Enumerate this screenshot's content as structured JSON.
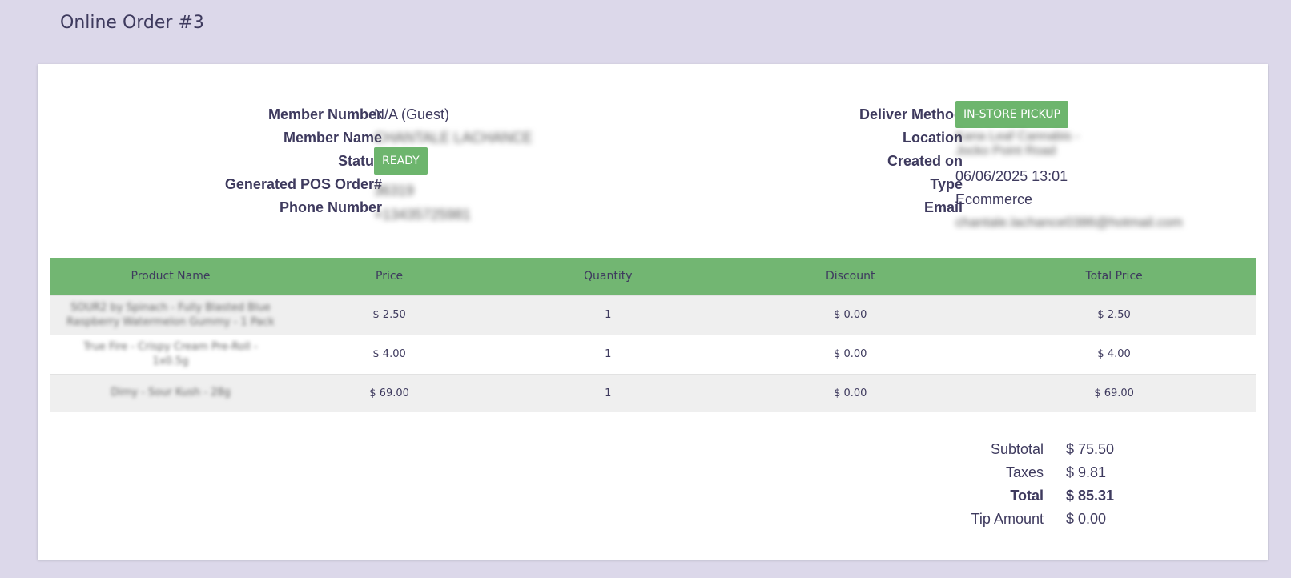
{
  "page": {
    "title": "Online Order #3"
  },
  "info_left": {
    "member_number_label": "Member Number",
    "member_number": "N/A (Guest)",
    "member_name_label": "Member Name",
    "member_name": "CHANTALE LACHANCE",
    "status_label": "Status",
    "status": "READY",
    "pos_order_label": "Generated POS Order#",
    "pos_order": "36319",
    "phone_label": "Phone Number",
    "phone": "+13435725981"
  },
  "info_right": {
    "deliver_method_label": "Deliver Method",
    "deliver_method": "IN-STORE PICKUP",
    "location_label": "Location",
    "location": "Kana Leaf Cannabis - Jocko Point Road",
    "created_on_label": "Created on",
    "created_on": "06/06/2025 13:01",
    "type_label": "Type",
    "type": "Ecommerce",
    "email_label": "Email",
    "email": "chantale.lachance0386@hotmail.com"
  },
  "table": {
    "headers": [
      "Product Name",
      "Price",
      "Quantity",
      "Discount",
      "Total Price"
    ],
    "rows": [
      {
        "name": "SOUR2 by Spinach - Fully Blasted Blue Raspberry Watermelon Gummy - 1 Pack",
        "price": "$ 2.50",
        "quantity": "1",
        "discount": "$ 0.00",
        "total": "$ 2.50"
      },
      {
        "name": "True Fire - Crispy Cream Pre-Roll - 1x0.5g",
        "price": "$ 4.00",
        "quantity": "1",
        "discount": "$ 0.00",
        "total": "$ 4.00"
      },
      {
        "name": "Dimy - Sour Kush - 28g",
        "price": "$ 69.00",
        "quantity": "1",
        "discount": "$ 0.00",
        "total": "$ 69.00"
      }
    ]
  },
  "totals": {
    "subtotal_label": "Subtotal",
    "subtotal": "$ 75.50",
    "taxes_label": "Taxes",
    "taxes": "$ 9.81",
    "total_label": "Total",
    "total": "$ 85.31",
    "tip_label": "Tip Amount",
    "tip": "$ 0.00"
  },
  "colors": {
    "background": "#dcd8ea",
    "badge": "#6db56d",
    "table_header": "#72b672",
    "text": "#3e3a5e"
  }
}
